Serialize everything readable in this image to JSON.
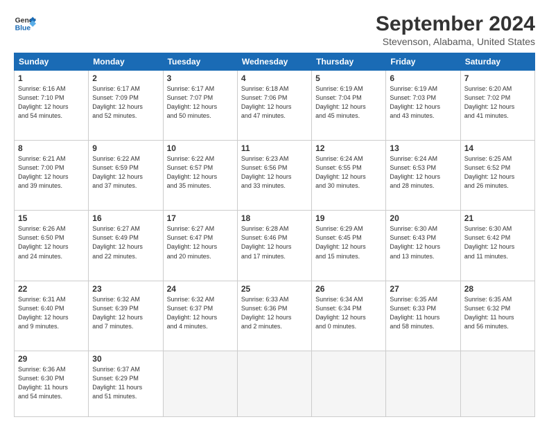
{
  "header": {
    "logo_line1": "General",
    "logo_line2": "Blue",
    "title": "September 2024",
    "subtitle": "Stevenson, Alabama, United States"
  },
  "days_of_week": [
    "Sunday",
    "Monday",
    "Tuesday",
    "Wednesday",
    "Thursday",
    "Friday",
    "Saturday"
  ],
  "weeks": [
    [
      {
        "day": 1,
        "info": "Sunrise: 6:16 AM\nSunset: 7:10 PM\nDaylight: 12 hours\nand 54 minutes."
      },
      {
        "day": 2,
        "info": "Sunrise: 6:17 AM\nSunset: 7:09 PM\nDaylight: 12 hours\nand 52 minutes."
      },
      {
        "day": 3,
        "info": "Sunrise: 6:17 AM\nSunset: 7:07 PM\nDaylight: 12 hours\nand 50 minutes."
      },
      {
        "day": 4,
        "info": "Sunrise: 6:18 AM\nSunset: 7:06 PM\nDaylight: 12 hours\nand 47 minutes."
      },
      {
        "day": 5,
        "info": "Sunrise: 6:19 AM\nSunset: 7:04 PM\nDaylight: 12 hours\nand 45 minutes."
      },
      {
        "day": 6,
        "info": "Sunrise: 6:19 AM\nSunset: 7:03 PM\nDaylight: 12 hours\nand 43 minutes."
      },
      {
        "day": 7,
        "info": "Sunrise: 6:20 AM\nSunset: 7:02 PM\nDaylight: 12 hours\nand 41 minutes."
      }
    ],
    [
      {
        "day": 8,
        "info": "Sunrise: 6:21 AM\nSunset: 7:00 PM\nDaylight: 12 hours\nand 39 minutes."
      },
      {
        "day": 9,
        "info": "Sunrise: 6:22 AM\nSunset: 6:59 PM\nDaylight: 12 hours\nand 37 minutes."
      },
      {
        "day": 10,
        "info": "Sunrise: 6:22 AM\nSunset: 6:57 PM\nDaylight: 12 hours\nand 35 minutes."
      },
      {
        "day": 11,
        "info": "Sunrise: 6:23 AM\nSunset: 6:56 PM\nDaylight: 12 hours\nand 33 minutes."
      },
      {
        "day": 12,
        "info": "Sunrise: 6:24 AM\nSunset: 6:55 PM\nDaylight: 12 hours\nand 30 minutes."
      },
      {
        "day": 13,
        "info": "Sunrise: 6:24 AM\nSunset: 6:53 PM\nDaylight: 12 hours\nand 28 minutes."
      },
      {
        "day": 14,
        "info": "Sunrise: 6:25 AM\nSunset: 6:52 PM\nDaylight: 12 hours\nand 26 minutes."
      }
    ],
    [
      {
        "day": 15,
        "info": "Sunrise: 6:26 AM\nSunset: 6:50 PM\nDaylight: 12 hours\nand 24 minutes."
      },
      {
        "day": 16,
        "info": "Sunrise: 6:27 AM\nSunset: 6:49 PM\nDaylight: 12 hours\nand 22 minutes."
      },
      {
        "day": 17,
        "info": "Sunrise: 6:27 AM\nSunset: 6:47 PM\nDaylight: 12 hours\nand 20 minutes."
      },
      {
        "day": 18,
        "info": "Sunrise: 6:28 AM\nSunset: 6:46 PM\nDaylight: 12 hours\nand 17 minutes."
      },
      {
        "day": 19,
        "info": "Sunrise: 6:29 AM\nSunset: 6:45 PM\nDaylight: 12 hours\nand 15 minutes."
      },
      {
        "day": 20,
        "info": "Sunrise: 6:30 AM\nSunset: 6:43 PM\nDaylight: 12 hours\nand 13 minutes."
      },
      {
        "day": 21,
        "info": "Sunrise: 6:30 AM\nSunset: 6:42 PM\nDaylight: 12 hours\nand 11 minutes."
      }
    ],
    [
      {
        "day": 22,
        "info": "Sunrise: 6:31 AM\nSunset: 6:40 PM\nDaylight: 12 hours\nand 9 minutes."
      },
      {
        "day": 23,
        "info": "Sunrise: 6:32 AM\nSunset: 6:39 PM\nDaylight: 12 hours\nand 7 minutes."
      },
      {
        "day": 24,
        "info": "Sunrise: 6:32 AM\nSunset: 6:37 PM\nDaylight: 12 hours\nand 4 minutes."
      },
      {
        "day": 25,
        "info": "Sunrise: 6:33 AM\nSunset: 6:36 PM\nDaylight: 12 hours\nand 2 minutes."
      },
      {
        "day": 26,
        "info": "Sunrise: 6:34 AM\nSunset: 6:34 PM\nDaylight: 12 hours\nand 0 minutes."
      },
      {
        "day": 27,
        "info": "Sunrise: 6:35 AM\nSunset: 6:33 PM\nDaylight: 11 hours\nand 58 minutes."
      },
      {
        "day": 28,
        "info": "Sunrise: 6:35 AM\nSunset: 6:32 PM\nDaylight: 11 hours\nand 56 minutes."
      }
    ],
    [
      {
        "day": 29,
        "info": "Sunrise: 6:36 AM\nSunset: 6:30 PM\nDaylight: 11 hours\nand 54 minutes."
      },
      {
        "day": 30,
        "info": "Sunrise: 6:37 AM\nSunset: 6:29 PM\nDaylight: 11 hours\nand 51 minutes."
      },
      null,
      null,
      null,
      null,
      null
    ]
  ]
}
